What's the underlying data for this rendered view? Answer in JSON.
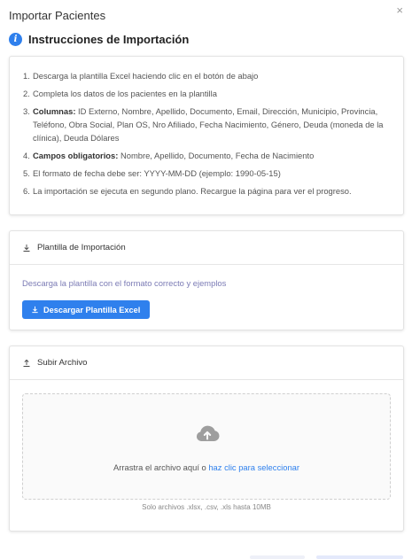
{
  "modal": {
    "title": "Importar Pacientes",
    "close_glyph": "×"
  },
  "instructions": {
    "title": "Instrucciones de Importación",
    "icon": "info-icon",
    "items": [
      {
        "num": "1.",
        "text": "Descarga la plantilla Excel haciendo clic en el botón de abajo"
      },
      {
        "num": "2.",
        "text": "Completa los datos de los pacientes en la plantilla"
      },
      {
        "num": "3.",
        "label": "Columnas:",
        "text": " ID Externo, Nombre, Apellido, Documento, Email, Dirección, Municipio, Provincia, Teléfono, Obra Social, Plan OS, Nro Afiliado, Fecha Nacimiento, Género, Deuda (moneda de la clínica), Deuda Dólares"
      },
      {
        "num": "4.",
        "label": "Campos obligatorios:",
        "text": " Nombre, Apellido, Documento, Fecha de Nacimiento"
      },
      {
        "num": "5.",
        "text": "El formato de fecha debe ser: YYYY-MM-DD (ejemplo: 1990-05-15)"
      },
      {
        "num": "6.",
        "text": "La importación se ejecuta en segundo plano. Recargue la página para ver el progreso."
      }
    ]
  },
  "template": {
    "title": "Plantilla de Importación",
    "description": "Descarga la plantilla con el formato correcto y ejemplos",
    "button_label": "Descargar Plantilla Excel",
    "button_color": "#2f80ed"
  },
  "upload": {
    "title": "Subir Archivo",
    "drop_text": "Arrastra el archivo aquí o ",
    "drop_link": "haz clic para seleccionar",
    "formats": "Solo archivos .xlsx, .csv, .xls hasta 10MB"
  }
}
